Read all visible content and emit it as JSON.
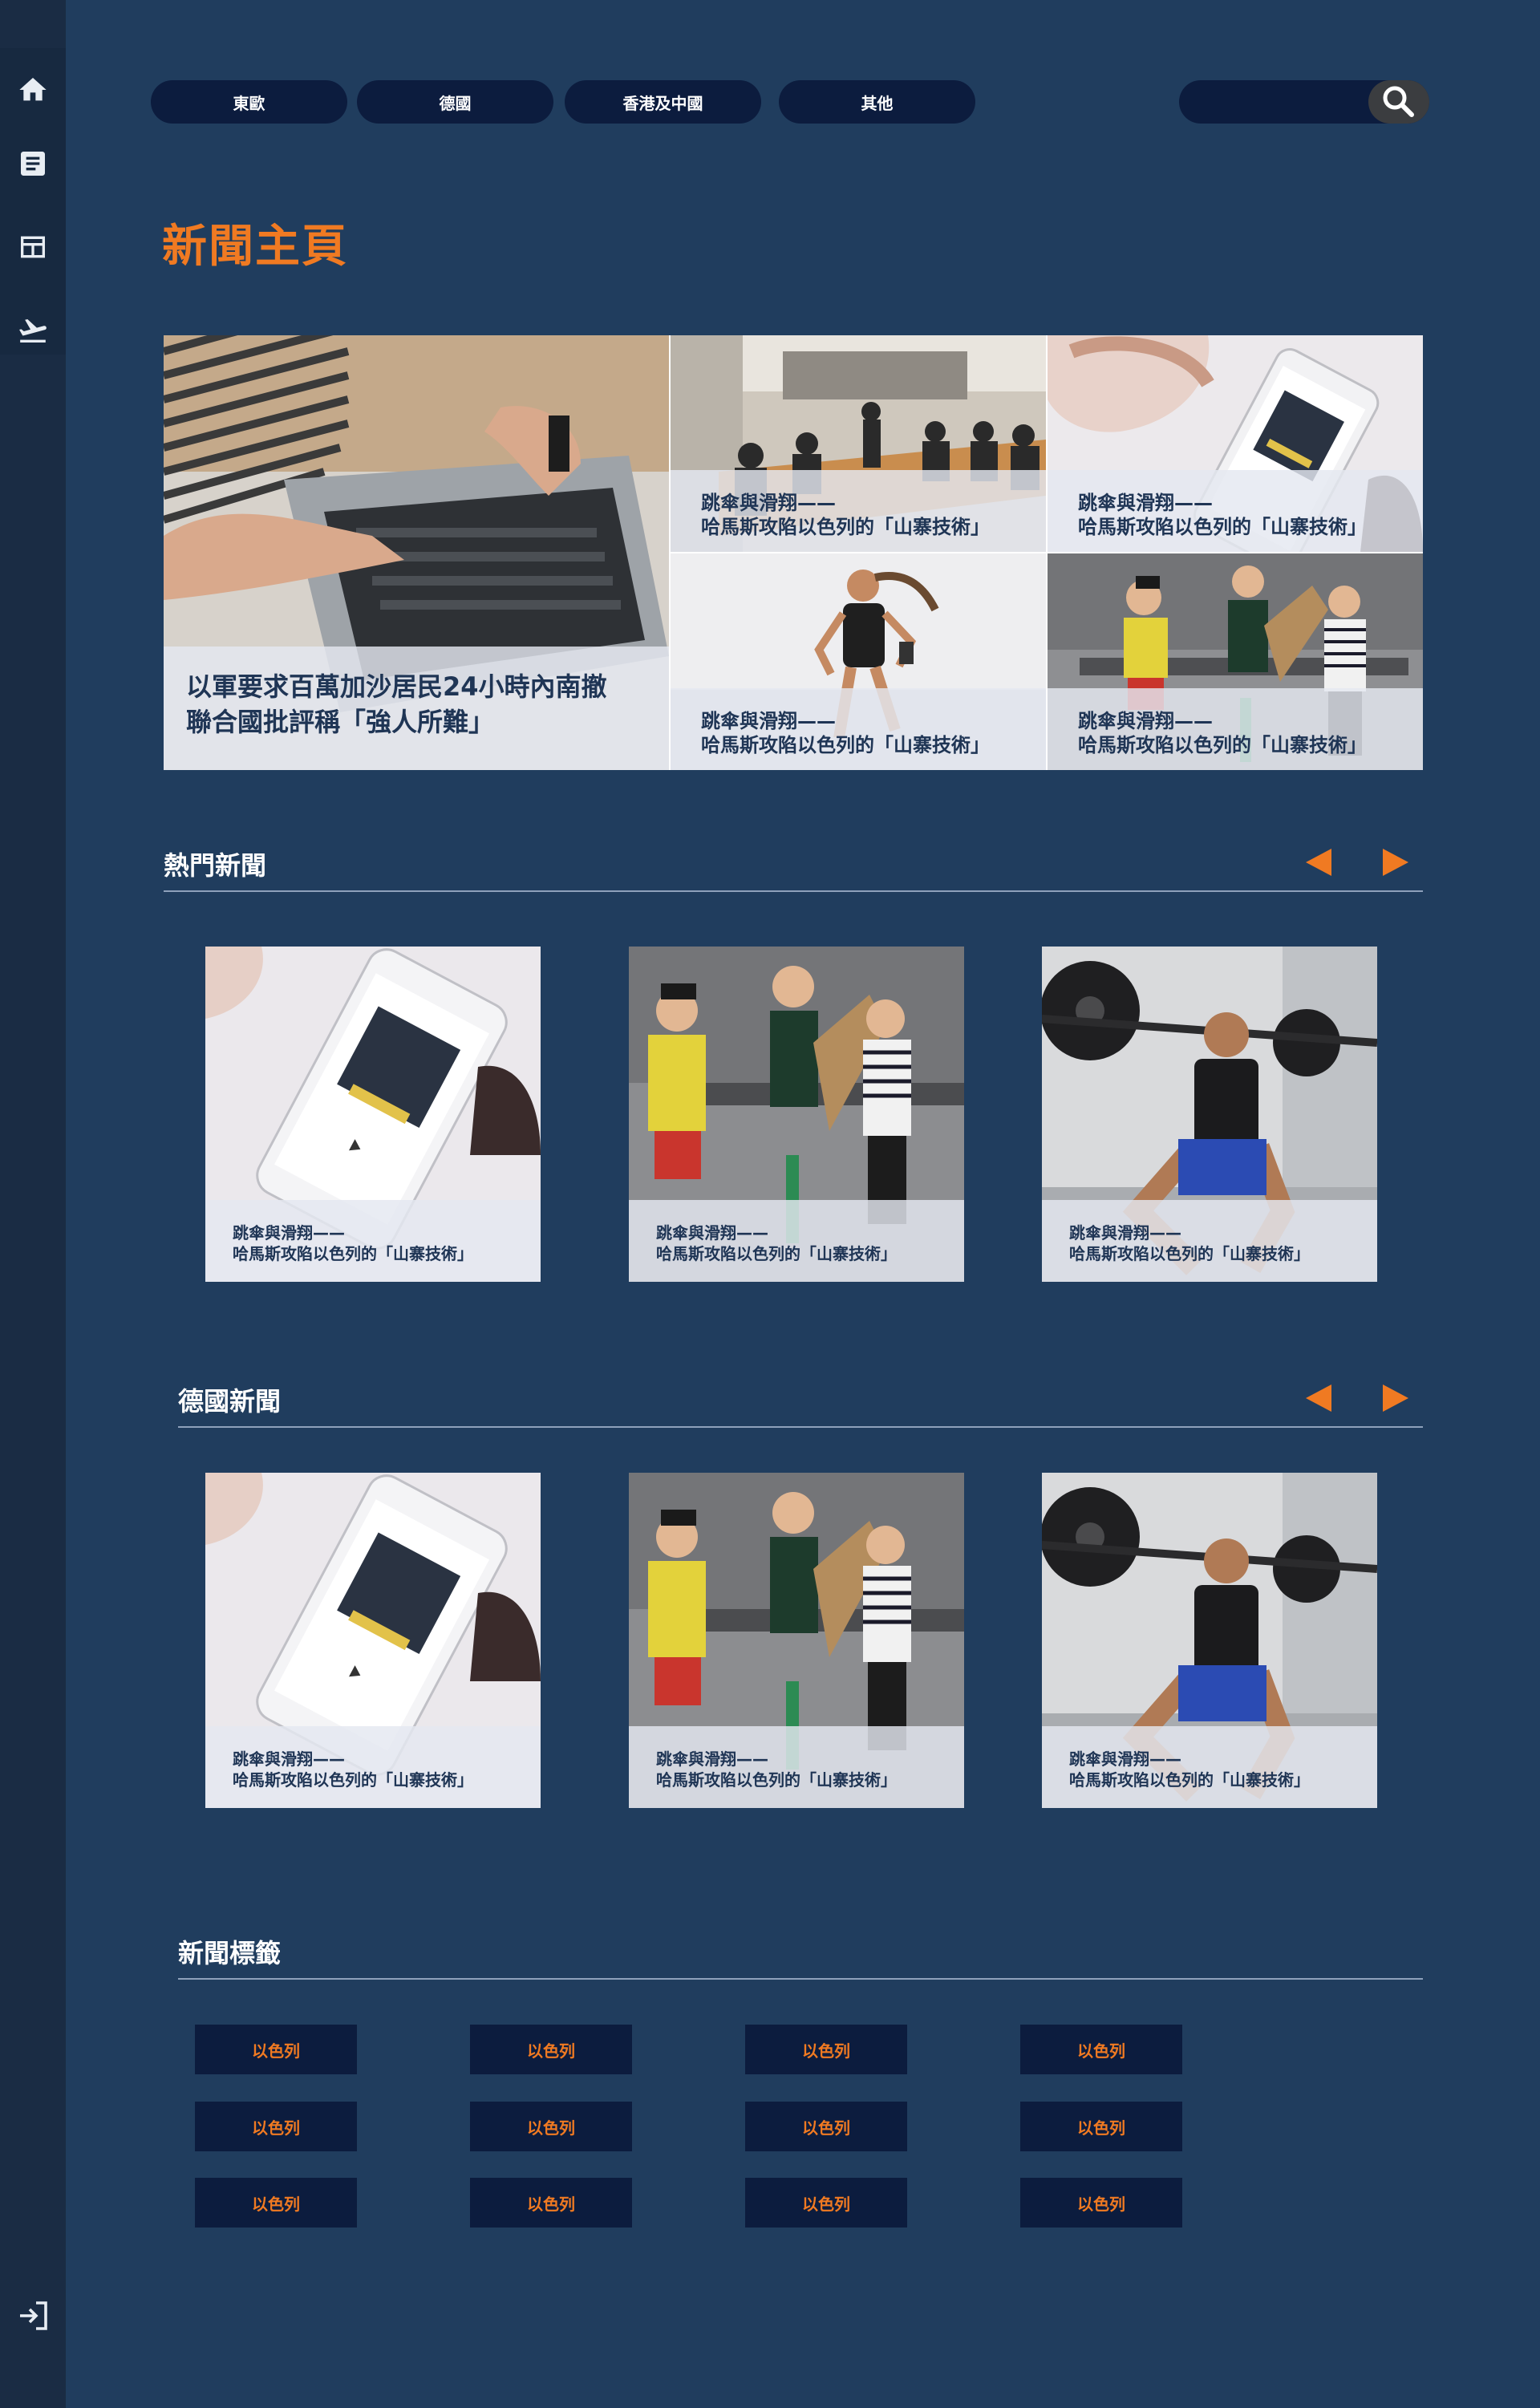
{
  "sidebar": {
    "items": [
      {
        "icon": "home-icon"
      },
      {
        "icon": "article-icon"
      },
      {
        "icon": "layout-icon"
      },
      {
        "icon": "flight-icon"
      }
    ],
    "logout_icon": "logout-icon"
  },
  "nav": {
    "tabs": [
      "東歐",
      "德國",
      "香港及中國",
      "其他"
    ]
  },
  "search": {
    "placeholder": "",
    "icon": "search-icon"
  },
  "page_title": "新聞主頁",
  "hero": {
    "main": {
      "line1": "以軍要求百萬加沙居民24小時內南撤",
      "line2": "聯合國批評稱「強人所難」"
    },
    "tiles": [
      {
        "line1": "跳傘與滑翔——",
        "line2": "哈馬斯攻陷以色列的「山寨技術」"
      },
      {
        "line1": "跳傘與滑翔——",
        "line2": "哈馬斯攻陷以色列的「山寨技術」"
      },
      {
        "line1": "跳傘與滑翔——",
        "line2": "哈馬斯攻陷以色列的「山寨技術」"
      },
      {
        "line1": "跳傘與滑翔——",
        "line2": "哈馬斯攻陷以色列的「山寨技術」"
      }
    ]
  },
  "hot_news": {
    "title": "熱門新聞",
    "cards": [
      {
        "line1": "跳傘與滑翔——",
        "line2": "哈馬斯攻陷以色列的「山寨技術」"
      },
      {
        "line1": "跳傘與滑翔——",
        "line2": "哈馬斯攻陷以色列的「山寨技術」"
      },
      {
        "line1": "跳傘與滑翔——",
        "line2": "哈馬斯攻陷以色列的「山寨技術」"
      }
    ]
  },
  "germany_news": {
    "title": "德國新聞",
    "cards": [
      {
        "line1": "跳傘與滑翔——",
        "line2": "哈馬斯攻陷以色列的「山寨技術」"
      },
      {
        "line1": "跳傘與滑翔——",
        "line2": "哈馬斯攻陷以色列的「山寨技術」"
      },
      {
        "line1": "跳傘與滑翔——",
        "line2": "哈馬斯攻陷以色列的「山寨技術」"
      }
    ]
  },
  "tags": {
    "title": "新聞標籤",
    "items": [
      "以色列",
      "以色列",
      "以色列",
      "以色列",
      "以色列",
      "以色列",
      "以色列",
      "以色列",
      "以色列",
      "以色列",
      "以色列",
      "以色列"
    ]
  },
  "colors": {
    "background": "#203d5e",
    "sidebar": "#1a2c44",
    "accent": "#f07a22",
    "button": "#0c1c3e",
    "caption_text": "#1f3555"
  }
}
